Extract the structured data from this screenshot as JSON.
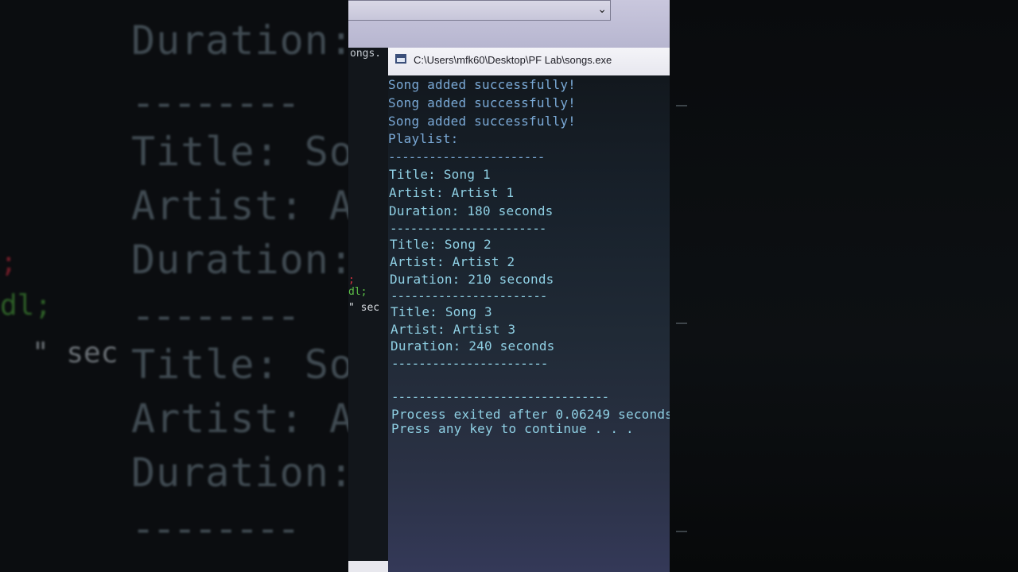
{
  "window": {
    "title": "C:\\Users\\mfk60\\Desktop\\PF Lab\\songs.exe",
    "app_icon": "console-window-icon"
  },
  "editor_behind": {
    "tab_label": "ongs.",
    "code_fragments": [
      "dl;",
      "\" sec"
    ]
  },
  "console": {
    "messages": [
      "Song added successfully!",
      "Song added successfully!",
      "Song added successfully!"
    ],
    "playlist_label": "Playlist:",
    "separator": "-----------------------",
    "songs": [
      {
        "title": "Title: Song 1",
        "artist": "Artist: Artist 1",
        "duration": "Duration: 180 seconds"
      },
      {
        "title": "Title: Song 2",
        "artist": "Artist: Artist 2",
        "duration": "Duration: 210 seconds"
      },
      {
        "title": "Title: Song 3",
        "artist": "Artist: Artist 3",
        "duration": "Duration: 240 seconds"
      }
    ],
    "long_separator": "--------------------------------",
    "process_exit": "Process exited after 0.06249 seconds",
    "press_key": "Press any key to continue . . ."
  },
  "background_blur": {
    "lines": [
      "Duration:",
      "--------",
      "Title: So",
      "Artist: A",
      "Duration:",
      "--------",
      "Title: So",
      "Artist: A",
      "Duration:",
      "--------"
    ],
    "code": [
      ";",
      "dl;",
      "\" sec"
    ]
  },
  "colors": {
    "console_text": "#8fd0e4",
    "console_text_blue": "#7aa9d6",
    "titlebar": "#f0f0f5"
  }
}
